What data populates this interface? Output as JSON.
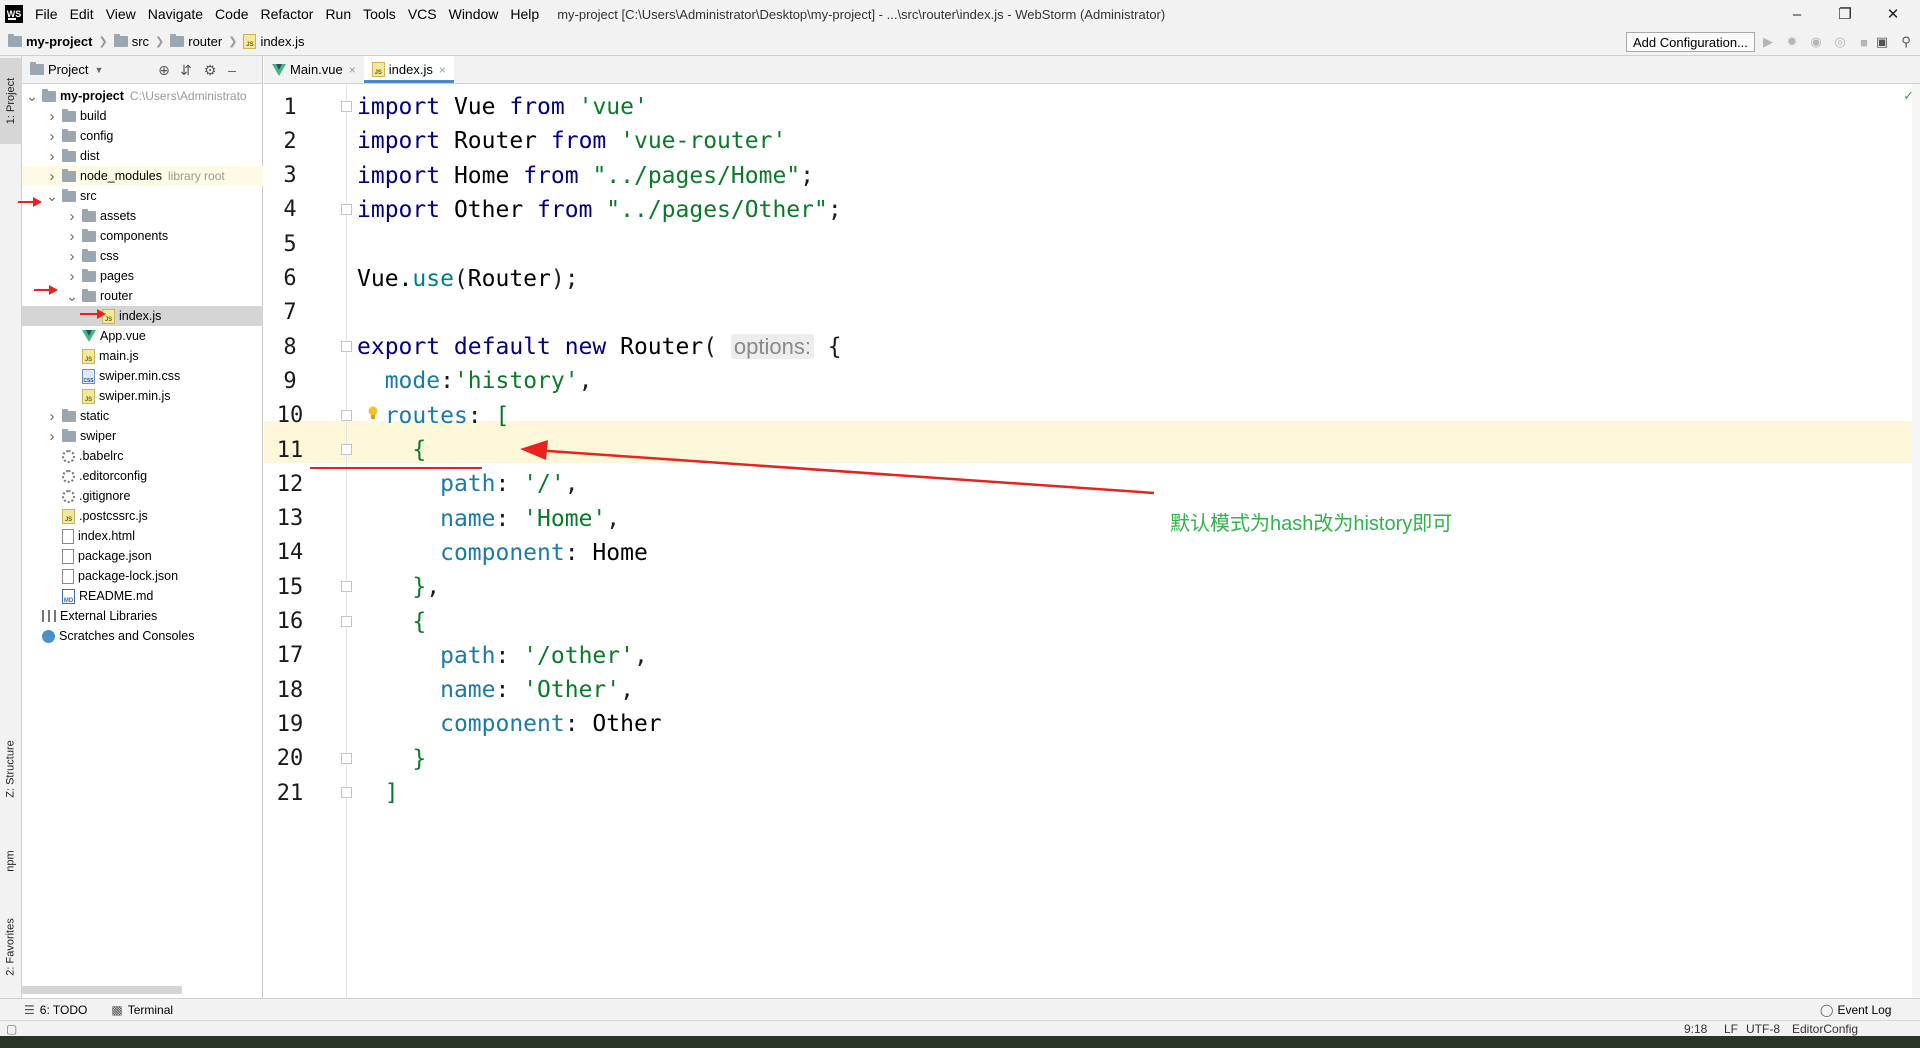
{
  "app": {
    "logo_text": "WS",
    "menus": [
      "File",
      "Edit",
      "View",
      "Navigate",
      "Code",
      "Refactor",
      "Run",
      "Tools",
      "VCS",
      "Window",
      "Help"
    ],
    "window_title": "my-project [C:\\Users\\Administrator\\Desktop\\my-project] - ...\\src\\router\\index.js - WebStorm (Administrator)"
  },
  "breadcrumb": [
    "my-project",
    "src",
    "router",
    "index.js"
  ],
  "toolbar": {
    "add_config_label": "Add Configuration..."
  },
  "left_stripe": {
    "project_tab": "1: Project",
    "structure_tab": "Z: Structure",
    "npm_tab": "npm",
    "favorites_tab": "2: Favorites"
  },
  "project_panel": {
    "title": "Project",
    "tree": [
      {
        "label": "my-project",
        "hint": "C:\\Users\\Administrato",
        "depth": 0,
        "icon": "folder",
        "expanded": true,
        "bold": true
      },
      {
        "label": "build",
        "depth": 1,
        "icon": "folder",
        "expanded": false
      },
      {
        "label": "config",
        "depth": 1,
        "icon": "folder",
        "expanded": false
      },
      {
        "label": "dist",
        "depth": 1,
        "icon": "folder",
        "expanded": false
      },
      {
        "label": "node_modules",
        "hint": "library root",
        "depth": 1,
        "icon": "folder",
        "expanded": false,
        "library": true
      },
      {
        "label": "src",
        "depth": 1,
        "icon": "folder",
        "expanded": true
      },
      {
        "label": "assets",
        "depth": 2,
        "icon": "folder",
        "expanded": false
      },
      {
        "label": "components",
        "depth": 2,
        "icon": "folder",
        "expanded": false
      },
      {
        "label": "css",
        "depth": 2,
        "icon": "folder",
        "expanded": false
      },
      {
        "label": "pages",
        "depth": 2,
        "icon": "folder",
        "expanded": false
      },
      {
        "label": "router",
        "depth": 2,
        "icon": "folder",
        "expanded": true
      },
      {
        "label": "index.js",
        "depth": 3,
        "icon": "js",
        "selected": true
      },
      {
        "label": "App.vue",
        "depth": 2,
        "icon": "vue"
      },
      {
        "label": "main.js",
        "depth": 2,
        "icon": "js"
      },
      {
        "label": "swiper.min.css",
        "depth": 2,
        "icon": "css"
      },
      {
        "label": "swiper.min.js",
        "depth": 2,
        "icon": "js"
      },
      {
        "label": "static",
        "depth": 1,
        "icon": "folder",
        "expanded": false
      },
      {
        "label": "swiper",
        "depth": 1,
        "icon": "folder",
        "expanded": false
      },
      {
        "label": ".babelrc",
        "depth": 1,
        "icon": "gear"
      },
      {
        "label": ".editorconfig",
        "depth": 1,
        "icon": "gear"
      },
      {
        "label": ".gitignore",
        "depth": 1,
        "icon": "gear"
      },
      {
        "label": ".postcssrc.js",
        "depth": 1,
        "icon": "js"
      },
      {
        "label": "index.html",
        "depth": 1,
        "icon": "file"
      },
      {
        "label": "package.json",
        "depth": 1,
        "icon": "file"
      },
      {
        "label": "package-lock.json",
        "depth": 1,
        "icon": "file"
      },
      {
        "label": "README.md",
        "depth": 1,
        "icon": "md"
      },
      {
        "label": "External Libraries",
        "depth": 0,
        "icon": "lib"
      },
      {
        "label": "Scratches and Consoles",
        "depth": 0,
        "icon": "scratch"
      }
    ]
  },
  "editor": {
    "tabs": [
      {
        "label": "Main.vue",
        "icon": "vue",
        "active": false
      },
      {
        "label": "index.js",
        "icon": "js",
        "active": true
      }
    ],
    "lines": [
      {
        "num": "1",
        "tokens": [
          [
            "kw",
            "import"
          ],
          [
            "",
            " Vue "
          ],
          [
            "kw",
            "from"
          ],
          [
            "",
            " "
          ],
          [
            "str",
            "'vue'"
          ]
        ]
      },
      {
        "num": "2",
        "tokens": [
          [
            "kw",
            "import"
          ],
          [
            "",
            " Router "
          ],
          [
            "kw",
            "from"
          ],
          [
            "",
            " "
          ],
          [
            "str",
            "'vue-router'"
          ]
        ]
      },
      {
        "num": "3",
        "tokens": [
          [
            "kw",
            "import"
          ],
          [
            "",
            " Home "
          ],
          [
            "kw",
            "from"
          ],
          [
            "",
            " "
          ],
          [
            "str",
            "\"../pages/Home\""
          ],
          [
            "punc",
            ";"
          ]
        ]
      },
      {
        "num": "4",
        "tokens": [
          [
            "kw",
            "import"
          ],
          [
            "",
            " Other "
          ],
          [
            "kw",
            "from"
          ],
          [
            "",
            " "
          ],
          [
            "str",
            "\"../pages/Other\""
          ],
          [
            "punc",
            ";"
          ]
        ]
      },
      {
        "num": "5",
        "tokens": []
      },
      {
        "num": "6",
        "tokens": [
          [
            "",
            "Vue."
          ],
          [
            "meth",
            "use"
          ],
          [
            "punc",
            "("
          ],
          [
            "",
            "Router"
          ],
          [
            "punc",
            ");"
          ]
        ]
      },
      {
        "num": "7",
        "tokens": []
      },
      {
        "num": "8",
        "tokens": [
          [
            "kw",
            "export default new"
          ],
          [
            "",
            " Router"
          ],
          [
            "punc",
            "( "
          ],
          [
            "hint",
            "options:"
          ],
          [
            "punc",
            " {"
          ]
        ]
      },
      {
        "num": "9",
        "tokens": [
          [
            "",
            "  "
          ],
          [
            "prop",
            "mode"
          ],
          [
            "punc",
            ":"
          ],
          [
            "str",
            "'history'"
          ],
          [
            "punc",
            ","
          ]
        ]
      },
      {
        "num": "10",
        "tokens": [
          [
            "",
            "  "
          ],
          [
            "prop",
            "routes"
          ],
          [
            "punc",
            ": "
          ],
          [
            "str",
            "["
          ]
        ]
      },
      {
        "num": "11",
        "tokens": [
          [
            "",
            "    "
          ],
          [
            "str",
            "{"
          ]
        ]
      },
      {
        "num": "12",
        "tokens": [
          [
            "",
            "      "
          ],
          [
            "prop",
            "path"
          ],
          [
            "punc",
            ": "
          ],
          [
            "str",
            "'/'"
          ],
          [
            "punc",
            ","
          ]
        ]
      },
      {
        "num": "13",
        "tokens": [
          [
            "",
            "      "
          ],
          [
            "prop",
            "name"
          ],
          [
            "punc",
            ": "
          ],
          [
            "str",
            "'Home'"
          ],
          [
            "punc",
            ","
          ]
        ]
      },
      {
        "num": "14",
        "tokens": [
          [
            "",
            "      "
          ],
          [
            "prop",
            "component"
          ],
          [
            "punc",
            ": "
          ],
          [
            "",
            "Home"
          ]
        ]
      },
      {
        "num": "15",
        "tokens": [
          [
            "",
            "    "
          ],
          [
            "str",
            "}"
          ],
          [
            "punc",
            ","
          ]
        ]
      },
      {
        "num": "16",
        "tokens": [
          [
            "",
            "    "
          ],
          [
            "str",
            "{"
          ]
        ]
      },
      {
        "num": "17",
        "tokens": [
          [
            "",
            "      "
          ],
          [
            "prop",
            "path"
          ],
          [
            "punc",
            ": "
          ],
          [
            "str",
            "'/other'"
          ],
          [
            "punc",
            ","
          ]
        ]
      },
      {
        "num": "18",
        "tokens": [
          [
            "",
            "      "
          ],
          [
            "prop",
            "name"
          ],
          [
            "punc",
            ": "
          ],
          [
            "str",
            "'Other'"
          ],
          [
            "punc",
            ","
          ]
        ]
      },
      {
        "num": "19",
        "tokens": [
          [
            "",
            "      "
          ],
          [
            "prop",
            "component"
          ],
          [
            "punc",
            ": "
          ],
          [
            "",
            "Other"
          ]
        ]
      },
      {
        "num": "20",
        "tokens": [
          [
            "",
            "    "
          ],
          [
            "str",
            "}"
          ]
        ]
      },
      {
        "num": "21",
        "tokens": [
          [
            "",
            "  "
          ],
          [
            "str",
            "]"
          ]
        ]
      }
    ],
    "annotation": "默认模式为hash改为history即可"
  },
  "bottom_tabs": {
    "todo": "6: TODO",
    "terminal": "Terminal",
    "event_log": "Event Log"
  },
  "status": {
    "position": "9:18",
    "line_sep": "LF",
    "encoding": "UTF-8",
    "editorconfig": "EditorConfig"
  },
  "colors": {
    "keyword": "#000080",
    "string": "#0a7a2a",
    "property": "#1b7aa7",
    "annotation": "#2fb34a",
    "arrow": "#e8231e",
    "current_line": "#fcf7d9"
  }
}
